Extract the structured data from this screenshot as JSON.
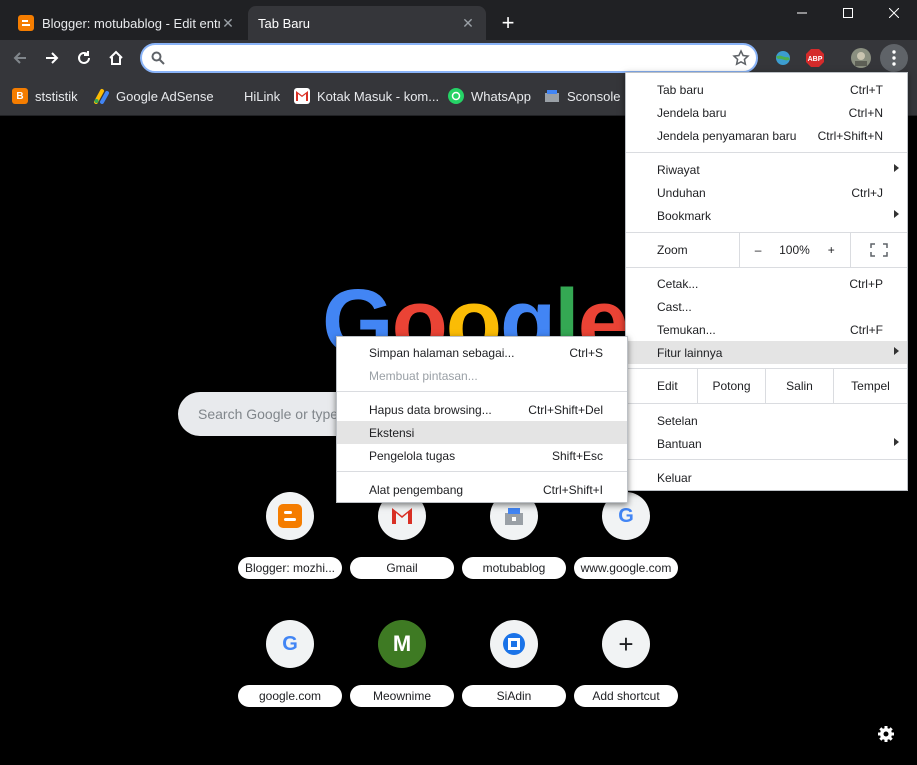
{
  "tabs": [
    {
      "title": "Blogger: motubablog - Edit entri",
      "close": "✕"
    },
    {
      "title": "Tab Baru",
      "close": "✕"
    }
  ],
  "new_tab": "+",
  "omnibox": {
    "value": "",
    "placeholder": ""
  },
  "bookmarks": [
    {
      "label": "ststistik",
      "icon": "blogger-icon"
    },
    {
      "label": "Google AdSense",
      "icon": "adsense-icon"
    },
    {
      "label": "HiLink",
      "icon": "none"
    },
    {
      "label": "Kotak Masuk - kom...",
      "icon": "gmail-icon"
    },
    {
      "label": "WhatsApp",
      "icon": "whatsapp-icon"
    },
    {
      "label": "Sconsole",
      "icon": "sconsole-icon"
    }
  ],
  "logo_text": "Google",
  "search_placeholder": "Search Google or type a URL",
  "shortcuts": [
    {
      "label": "Blogger: mozhi...",
      "icon": "blogger-icon"
    },
    {
      "label": "Gmail",
      "icon": "gmail-icon"
    },
    {
      "label": "motubablog",
      "icon": "site-icon"
    },
    {
      "label": "www.google.com",
      "icon": "google-g-icon",
      "glyph": "G"
    },
    {
      "label": "google.com",
      "icon": "google-g-icon",
      "glyph": "G"
    },
    {
      "label": "Meownime",
      "icon": "letter-avatar",
      "glyph": "M"
    },
    {
      "label": "SiAdin",
      "icon": "siadin-icon"
    },
    {
      "label": "Add shortcut",
      "icon": "plus-icon",
      "glyph": "+"
    }
  ],
  "main_menu": {
    "items": [
      {
        "label": "Tab baru",
        "shortcut": "Ctrl+T"
      },
      {
        "label": "Jendela baru",
        "shortcut": "Ctrl+N"
      },
      {
        "label": "Jendela penyamaran baru",
        "shortcut": "Ctrl+Shift+N"
      },
      {
        "label": "Riwayat",
        "shortcut": ""
      },
      {
        "label": "Unduhan",
        "shortcut": "Ctrl+J"
      },
      {
        "label": "Bookmark",
        "shortcut": ""
      },
      {
        "label": "Cetak...",
        "shortcut": "Ctrl+P"
      },
      {
        "label": "Cast...",
        "shortcut": ""
      },
      {
        "label": "Temukan...",
        "shortcut": "Ctrl+F"
      },
      {
        "label": "Fitur lainnya",
        "shortcut": ""
      },
      {
        "label": "Setelan",
        "shortcut": ""
      },
      {
        "label": "Bantuan",
        "shortcut": ""
      },
      {
        "label": "Keluar",
        "shortcut": ""
      }
    ],
    "zoom": {
      "label": "Zoom",
      "minus": "–",
      "value": "100%",
      "plus": "+"
    },
    "edit": {
      "label": "Edit",
      "cut": "Potong",
      "copy": "Salin",
      "paste": "Tempel"
    }
  },
  "sub_menu": {
    "items": [
      {
        "label": "Simpan halaman sebagai...",
        "shortcut": "Ctrl+S"
      },
      {
        "label": "Membuat pintasan...",
        "shortcut": ""
      },
      {
        "label": "Hapus data browsing...",
        "shortcut": "Ctrl+Shift+Del"
      },
      {
        "label": "Ekstensi",
        "shortcut": ""
      },
      {
        "label": "Pengelola tugas",
        "shortcut": "Shift+Esc"
      },
      {
        "label": "Alat pengembang",
        "shortcut": "Ctrl+Shift+I"
      }
    ]
  },
  "colors": {
    "accent": "#8ab4f8",
    "blogger": "#f57d00",
    "menu_highlight": "#e4e4e4"
  }
}
